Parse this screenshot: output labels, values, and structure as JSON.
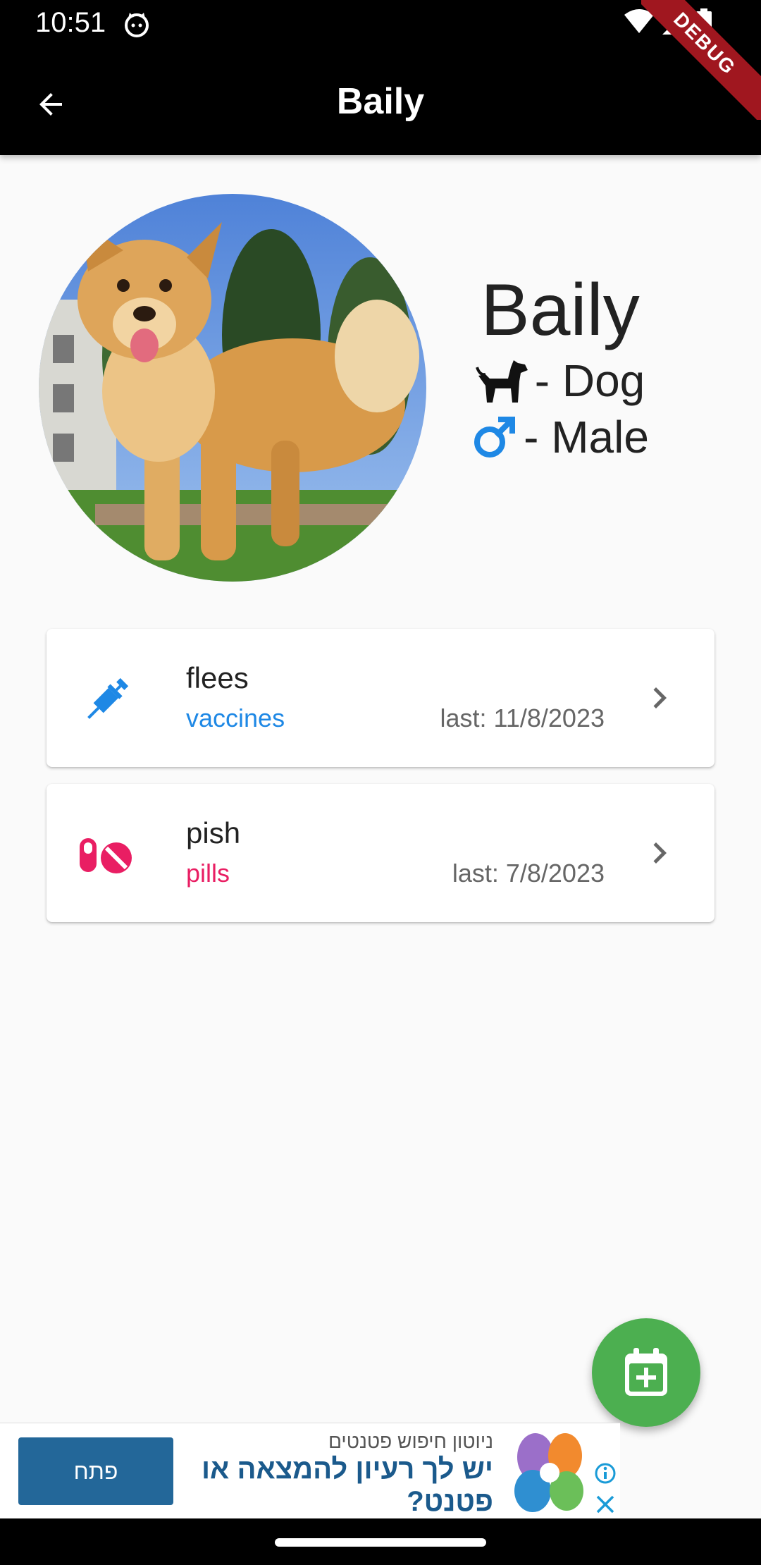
{
  "status_bar": {
    "time": "10:51"
  },
  "app_bar": {
    "title": "Baily",
    "debug_label": "DEBUG"
  },
  "pet": {
    "name": "Baily",
    "species_text": "- Dog",
    "gender_text": "- Male",
    "species_icon": "dog-icon",
    "gender_icon": "male-icon"
  },
  "records": [
    {
      "title": "flees",
      "type": "vaccines",
      "last": "last: 11/8/2023",
      "icon": "syringe-icon",
      "color": "#1e88e5"
    },
    {
      "title": "pish",
      "type": "pills",
      "last": "last: 7/8/2023",
      "icon": "pills-icon",
      "color": "#e91e63"
    }
  ],
  "fab": {
    "icon": "calendar-add-icon",
    "color": "#4caf50"
  },
  "ad": {
    "button_label": "פתח",
    "sponsor": "ניוטון חיפוש פטנטים",
    "headline": "יש לך רעיון להמצאה או פטנט?"
  },
  "colors": {
    "app_bar": "#000000",
    "background": "#fafafa",
    "accent_blue": "#1e88e5",
    "accent_pink": "#e91e63"
  }
}
